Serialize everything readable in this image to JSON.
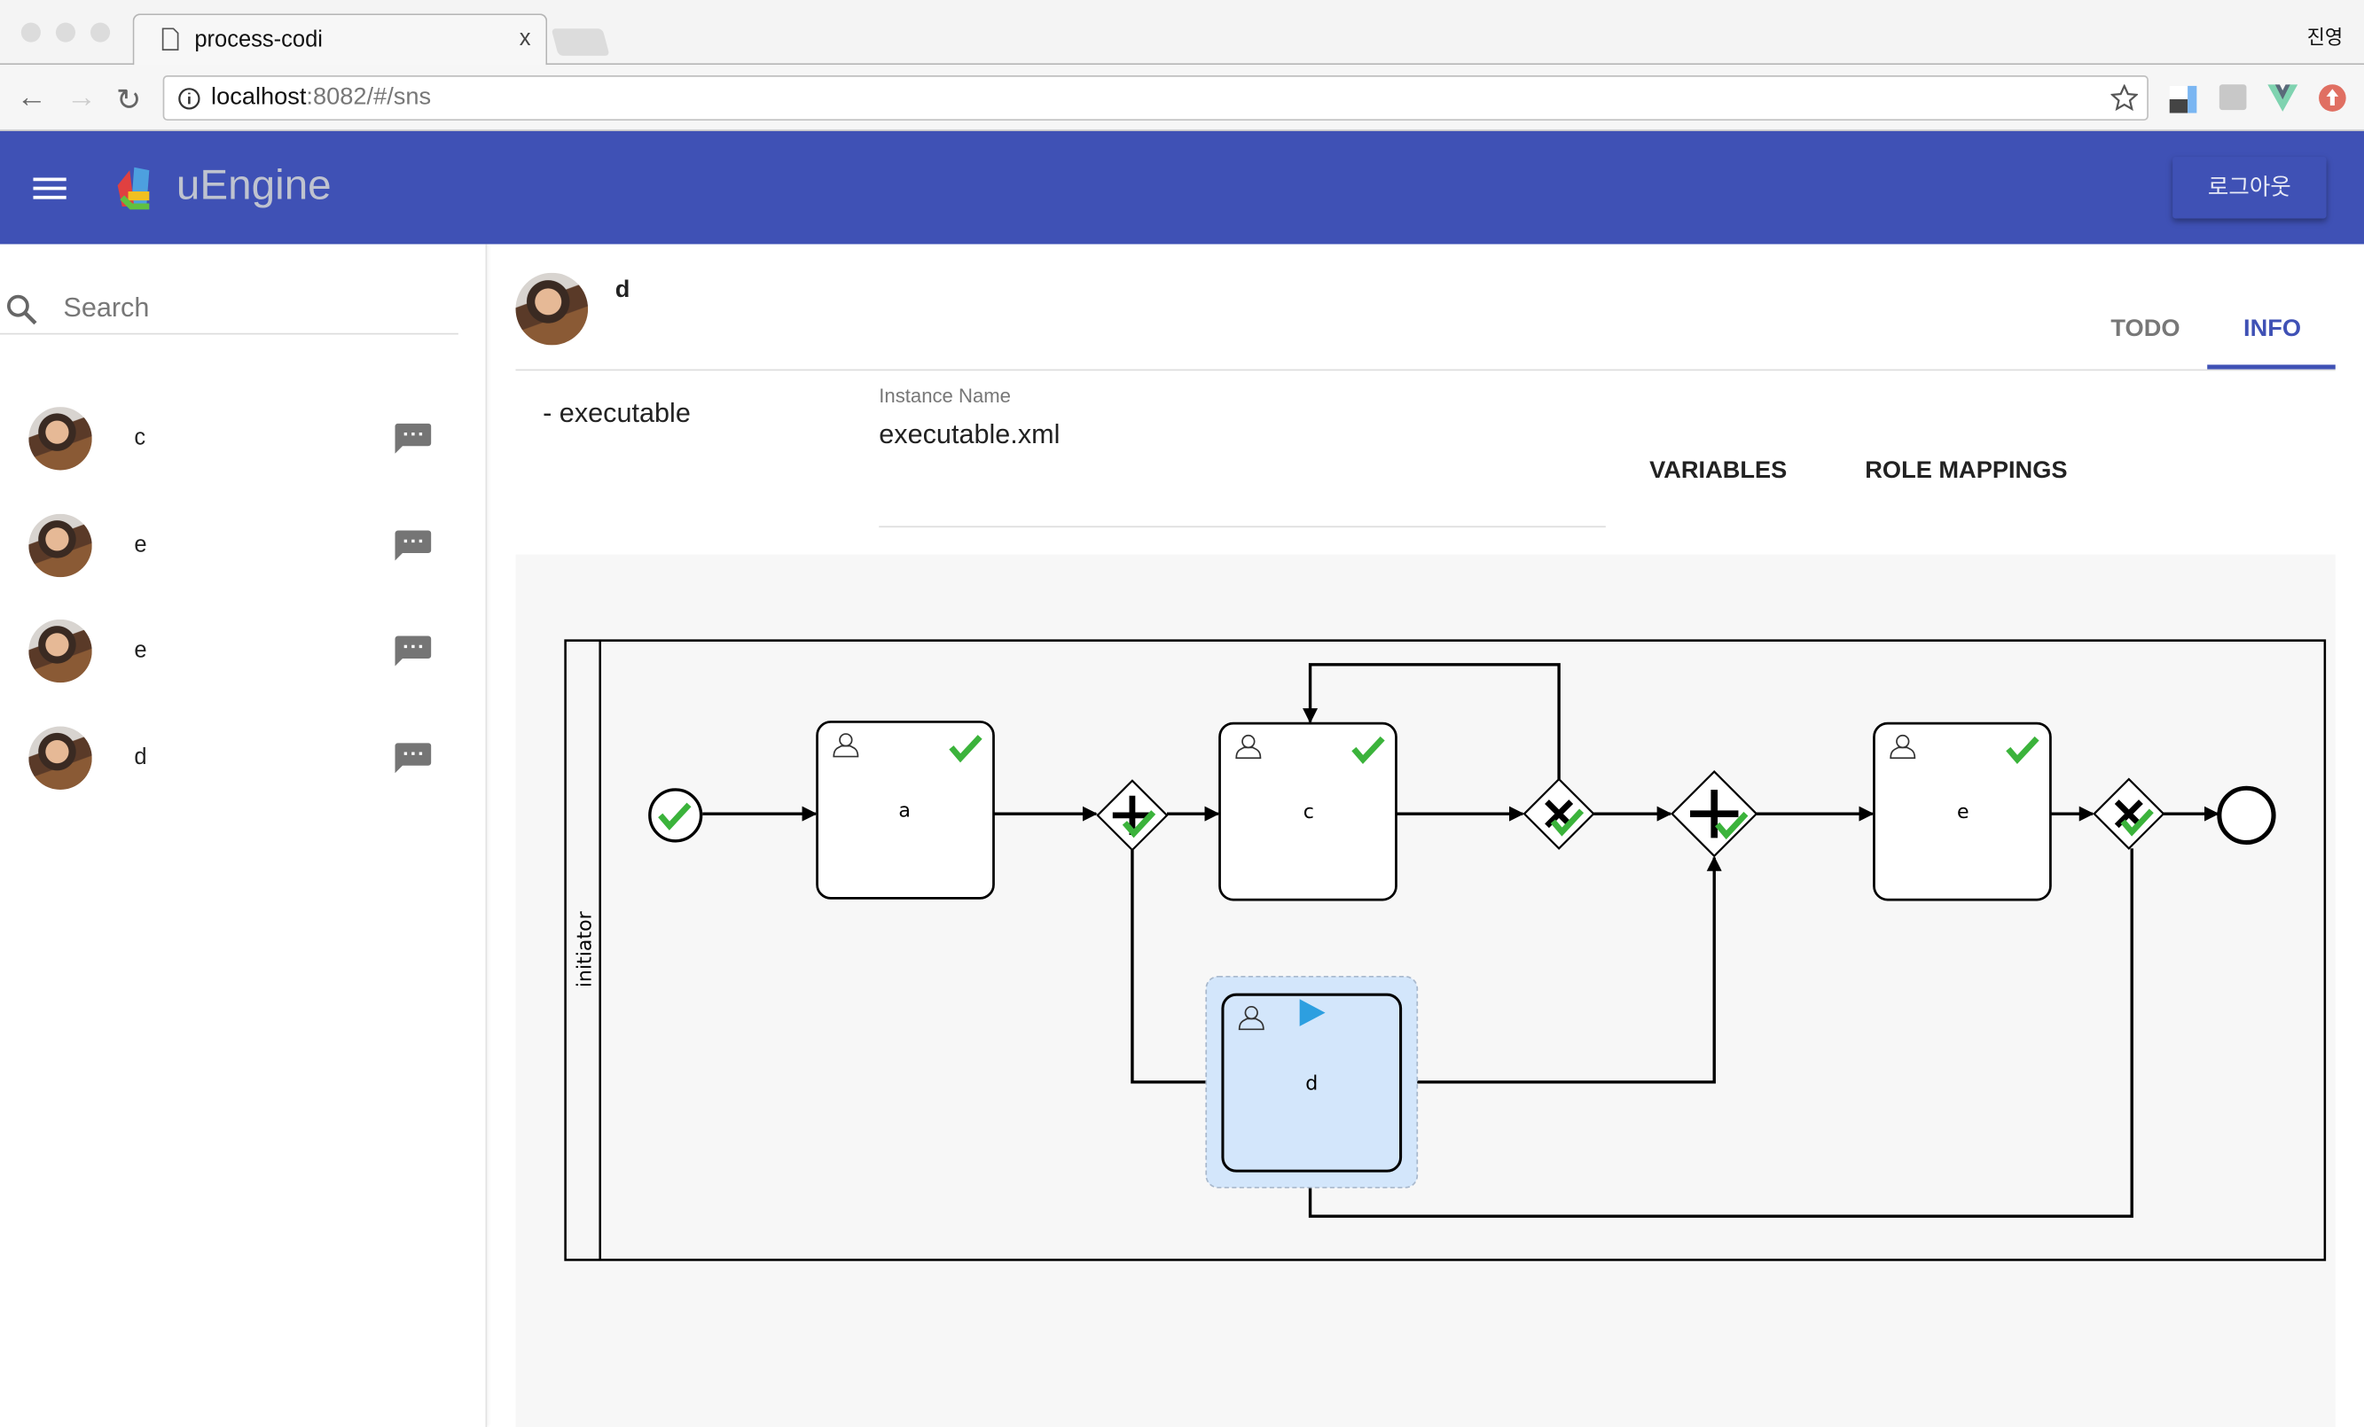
{
  "browser": {
    "tab_title": "process-codi",
    "tab_close": "x",
    "profile_name": "진영",
    "url_host": "localhost",
    "url_rest": ":8082/#/sns",
    "extensions": [
      "extension-grid-icon",
      "extension-ys-icon",
      "vue-devtools-icon",
      "upload-icon"
    ]
  },
  "header": {
    "logo_text": "uEngine",
    "logout_label": "로그아웃",
    "color": "#3f51b5"
  },
  "sidebar": {
    "search_placeholder": "Search",
    "items": [
      {
        "label": "c"
      },
      {
        "label": "e"
      },
      {
        "label": "e"
      },
      {
        "label": "d"
      }
    ]
  },
  "main": {
    "title": "d",
    "tabs": [
      {
        "label": "TODO",
        "active": false
      },
      {
        "label": "INFO",
        "active": true
      }
    ],
    "process_name": "-  executable",
    "instance_name_label": "Instance Name",
    "instance_name_value": "executable.xml",
    "buttons": {
      "variables": "VARIABLES",
      "role_mappings": "ROLE MAPPINGS"
    }
  },
  "diagram": {
    "lane": "initiator",
    "tasks": {
      "a": "a",
      "c": "c",
      "d": "d",
      "e": "e"
    },
    "status": {
      "start": "completed",
      "a": "completed",
      "c": "completed",
      "e": "completed",
      "d": "running"
    },
    "colors": {
      "completed": "#3bb33b",
      "running": "#2d9fe0",
      "running_fill": "#d3e6fb"
    }
  }
}
